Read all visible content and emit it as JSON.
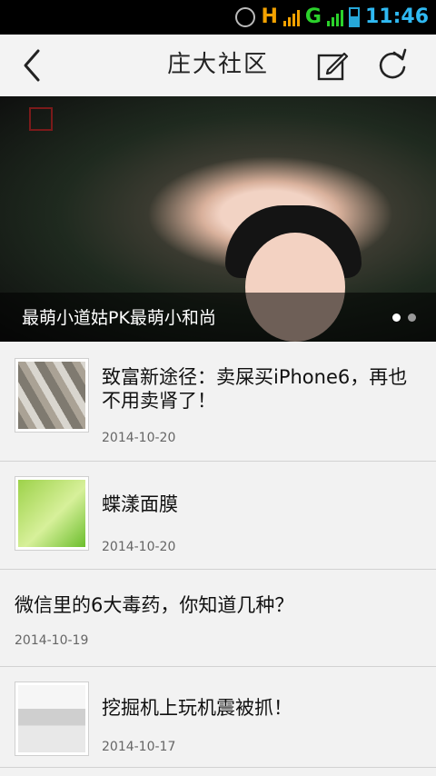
{
  "status_bar": {
    "network_1": "H",
    "network_2": "G",
    "time": "11:46"
  },
  "header": {
    "title": "庄大社区",
    "back_icon": "chevron-left-icon",
    "edit_icon": "edit-icon",
    "refresh_icon": "refresh-icon"
  },
  "banner": {
    "caption": "最萌小道姑PK最萌小和尚",
    "slide_index": 1,
    "slide_count": 2
  },
  "items": [
    {
      "title": "致富新途径：卖屎买iPhone6，再也不用卖肾了！",
      "date": "2014-10-20"
    },
    {
      "title": "蝶漾面膜",
      "date": "2014-10-20"
    },
    {
      "title": "微信里的6大毒药，你知道几种？",
      "date": "2014-10-19"
    },
    {
      "title": "挖掘机上玩机震被抓！",
      "date": "2014-10-17"
    }
  ]
}
